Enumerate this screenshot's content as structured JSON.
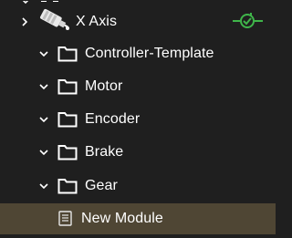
{
  "tree": {
    "axis": {
      "label": "X Axis",
      "icon": "motor-axis-icon",
      "status_icon": "connected-plug-icon",
      "status_color": "#3fb54a"
    },
    "folders": [
      {
        "label": "Controller-Template",
        "icon": "folder-icon"
      },
      {
        "label": "Motor",
        "icon": "folder-icon"
      },
      {
        "label": "Encoder",
        "icon": "folder-icon"
      },
      {
        "label": "Brake",
        "icon": "folder-icon"
      },
      {
        "label": "Gear",
        "icon": "folder-icon"
      }
    ],
    "module": {
      "label": "New Module",
      "icon": "document-icon",
      "selected": true
    }
  },
  "colors": {
    "background": "#1f1f1f",
    "selection": "#4f4634",
    "text": "#ffffff"
  }
}
